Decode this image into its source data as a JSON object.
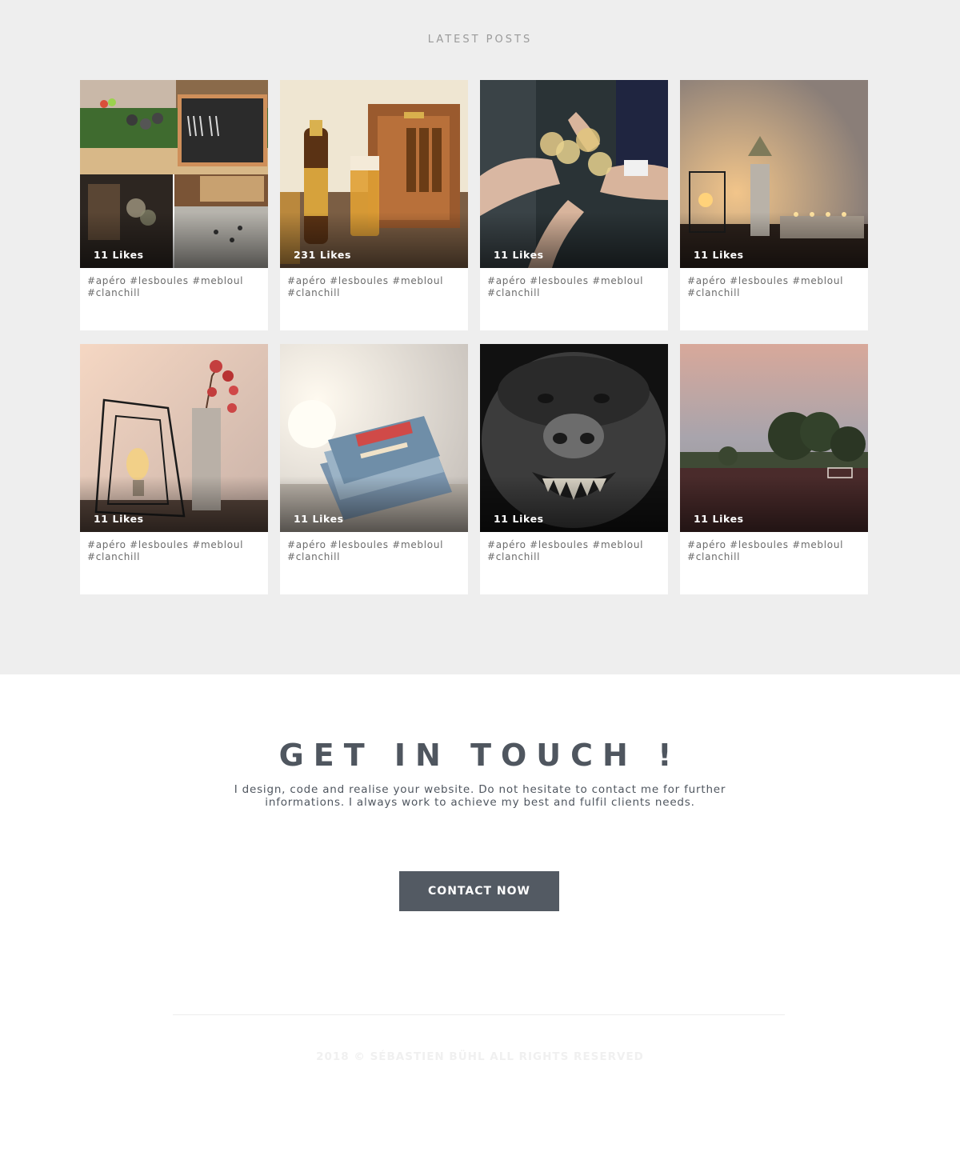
{
  "posts_section": {
    "title": "LATEST POSTS",
    "posts": [
      {
        "likes": "11 Likes",
        "caption": "#apéro #lesboules #mebloul #clanchill",
        "image": "petanque-scoreboard-collage"
      },
      {
        "likes": "231 Likes",
        "caption": "#apéro #lesboules #mebloul #clanchill",
        "image": "beer-crate"
      },
      {
        "likes": "11 Likes",
        "caption": "#apéro #lesboules #mebloul #clanchill",
        "image": "glasses-toast"
      },
      {
        "likes": "11 Likes",
        "caption": "#apéro #lesboules #mebloul #clanchill",
        "image": "lamp-candles"
      },
      {
        "likes": "11 Likes",
        "caption": "#apéro #lesboules #mebloul #clanchill",
        "image": "wire-lamp-flowers"
      },
      {
        "likes": "11 Likes",
        "caption": "#apéro #lesboules #mebloul #clanchill",
        "image": "books-stack"
      },
      {
        "likes": "11 Likes",
        "caption": "#apéro #lesboules #mebloul #clanchill",
        "image": "gorilla"
      },
      {
        "likes": "11 Likes",
        "caption": "#apéro #lesboules #mebloul #clanchill",
        "image": "sports-field-sunset"
      }
    ]
  },
  "contact": {
    "title": "GET IN TOUCH !",
    "text": "I design, code and realise your website. Do not hesitate to contact me for further informations. I always work to achieve my best and fulfil clients needs.",
    "button_label": "CONTACT NOW"
  },
  "footer": {
    "copyright": "2018 © SÉBASTIEN BÜHL ALL RIGHTS RESERVED"
  },
  "colors": {
    "section_bg": "#eeeeee",
    "heading": "#4f565f",
    "button_bg": "#535a63"
  }
}
